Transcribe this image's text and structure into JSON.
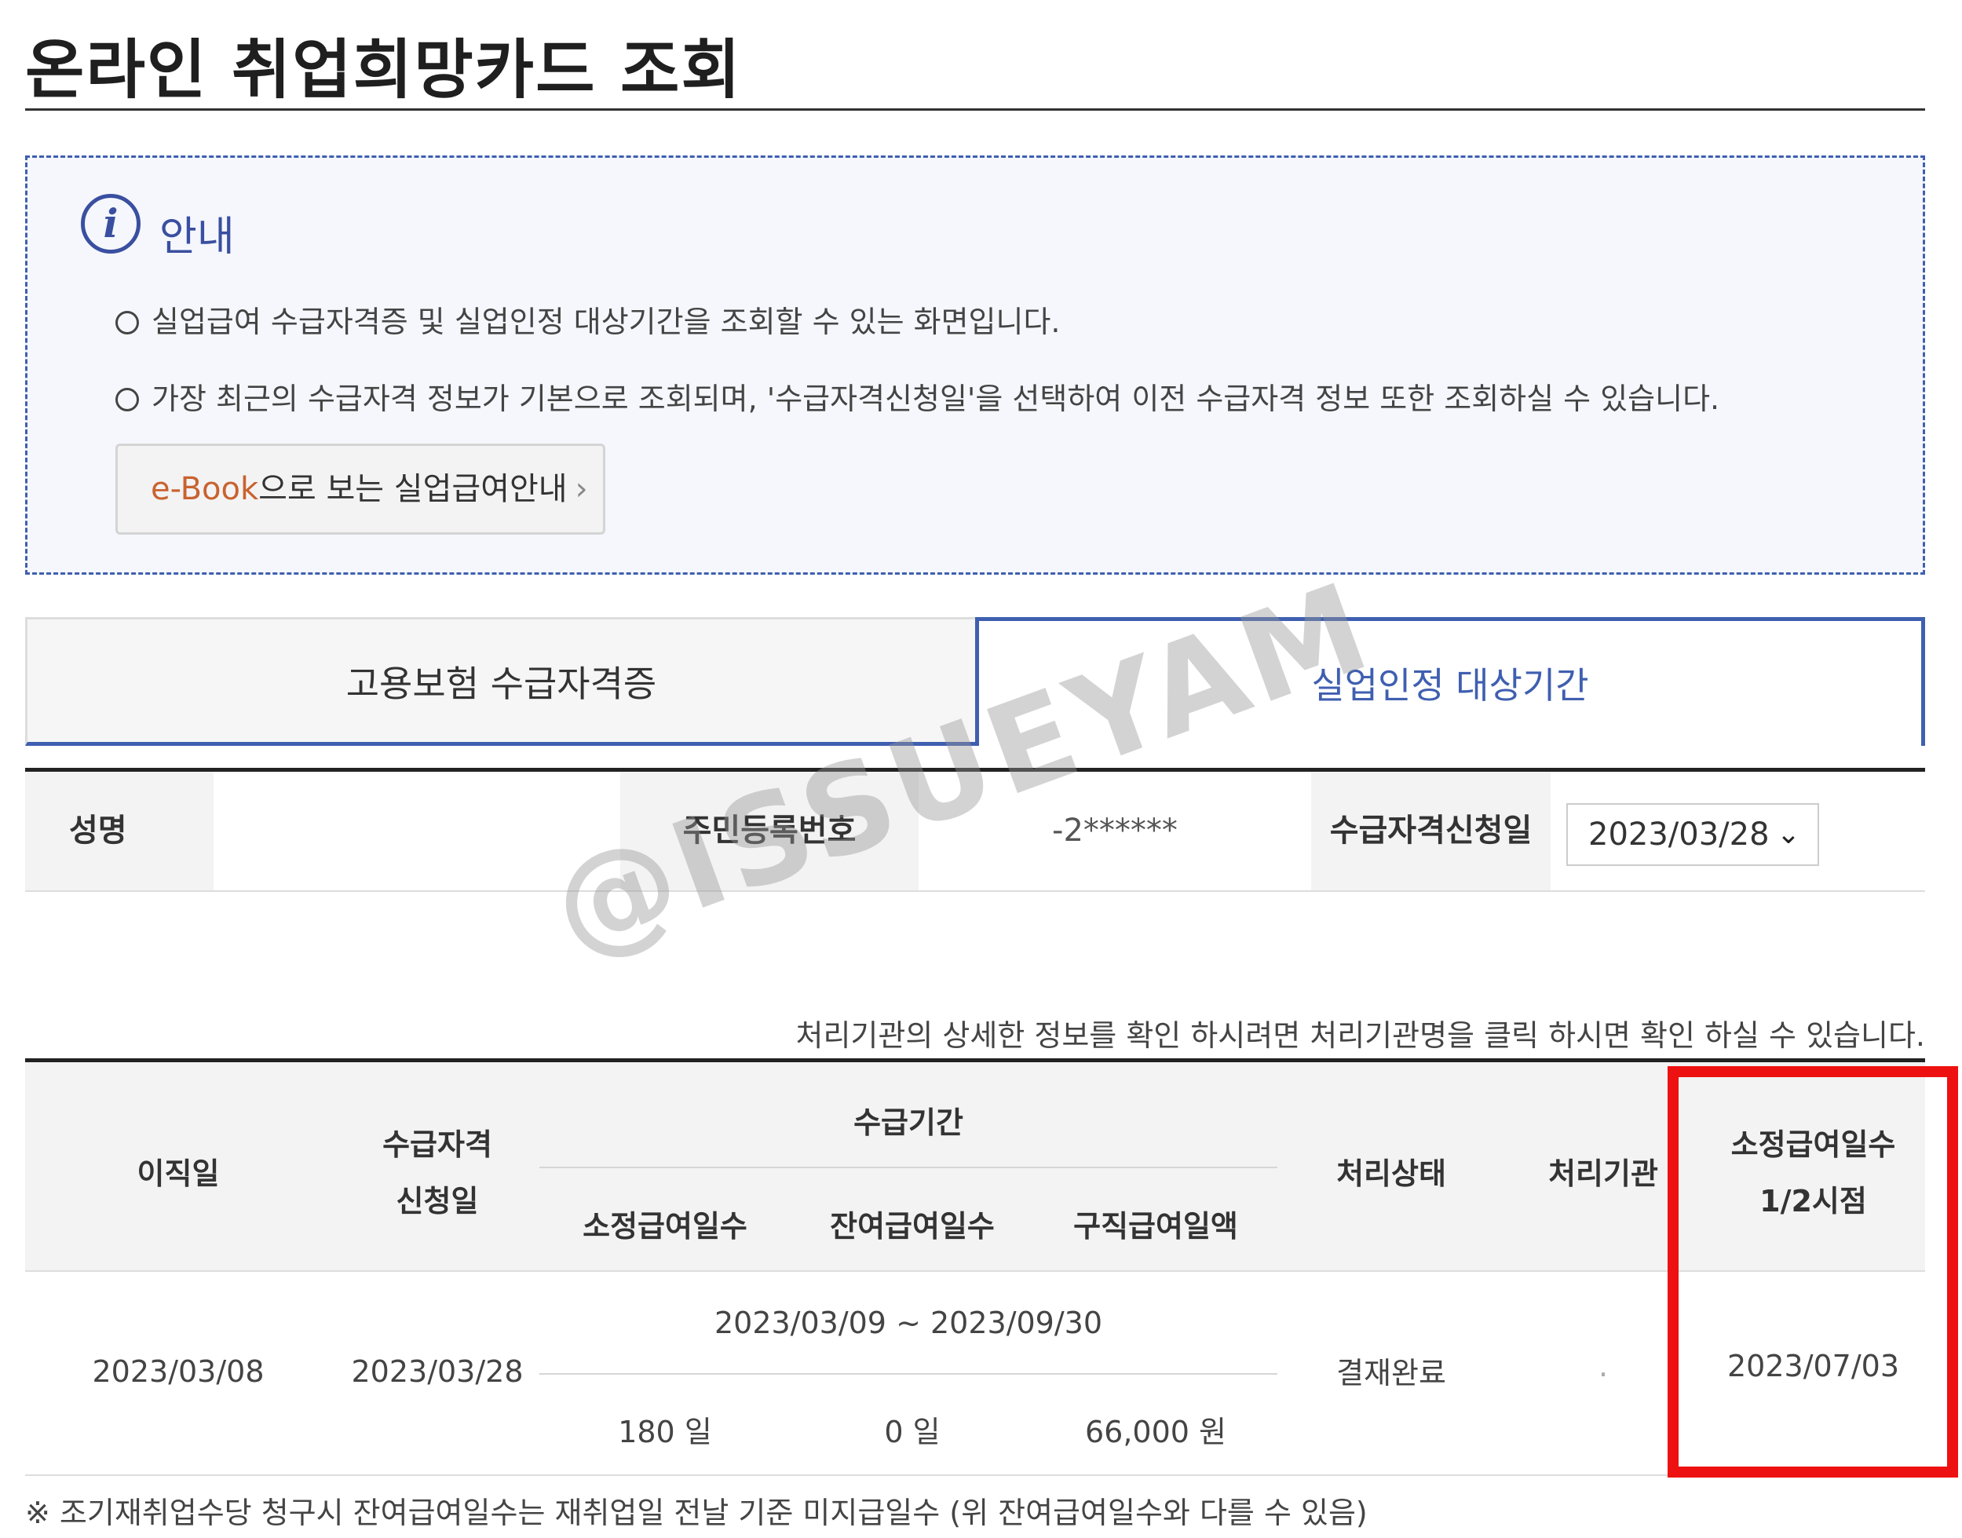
{
  "page": {
    "title": "온라인 취업희망카드 조회"
  },
  "info": {
    "heading": "안내",
    "lines": [
      "실업급여 수급자격증 및 실업인정 대상기간을 조회할 수 있는 화면입니다.",
      "가장 최근의 수급자격 정보가 기본으로 조회되며, '수급자격신청일'을 선택하여 이전 수급자격 정보 또한 조회하실 수 있습니다."
    ],
    "ebook_highlight": "e-Book",
    "ebook_label": "으로 보는 실업급여안내",
    "ebook_chevron": "›"
  },
  "tabs": [
    {
      "label": "고용보험 수급자격증",
      "active": false
    },
    {
      "label": "실업인정 대상기간",
      "active": true
    }
  ],
  "person": {
    "name_label": "성명",
    "name_value": "",
    "rrn_label": "주민등록번호",
    "rrn_value": "-2******",
    "apply_date_label": "수급자격신청일",
    "apply_date_value": "2023/03/28"
  },
  "watermark": "@ISSUEYAM",
  "note": "처리기관의 상세한 정보를 확인 하시려면 처리기관명을 클릭 하시면 확인 하실 수 있습니다.",
  "table": {
    "headers": {
      "leave_date": "이직일",
      "apply_date_line1": "수급자격",
      "apply_date_line2": "신청일",
      "period": "수급기간",
      "prescribed_days": "소정급여일수",
      "remaining_days": "잔여급여일수",
      "daily_amount": "구직급여일액",
      "status": "처리상태",
      "agency": "처리기관",
      "half_point_line1": "소정급여일수",
      "half_point_line2": "1/2시점"
    },
    "row": {
      "leave_date": "2023/03/08",
      "apply_date": "2023/03/28",
      "period": "2023/03/09 ~ 2023/09/30",
      "prescribed_days": "180 일",
      "remaining_days": "0 일",
      "daily_amount": "66,000 원",
      "status": "결재완료",
      "agency": ".",
      "half_point": "2023/07/03"
    }
  },
  "footnote": "※ 조기재취업수당 청구시 잔여급여일수는 재취업일 전날 기준 미지급일수 (위 잔여급여일수와 다를 수 있음)",
  "colors": {
    "accent": "#3f5fb0",
    "highlight": "#ee1111",
    "ebook": "#c9622f"
  }
}
